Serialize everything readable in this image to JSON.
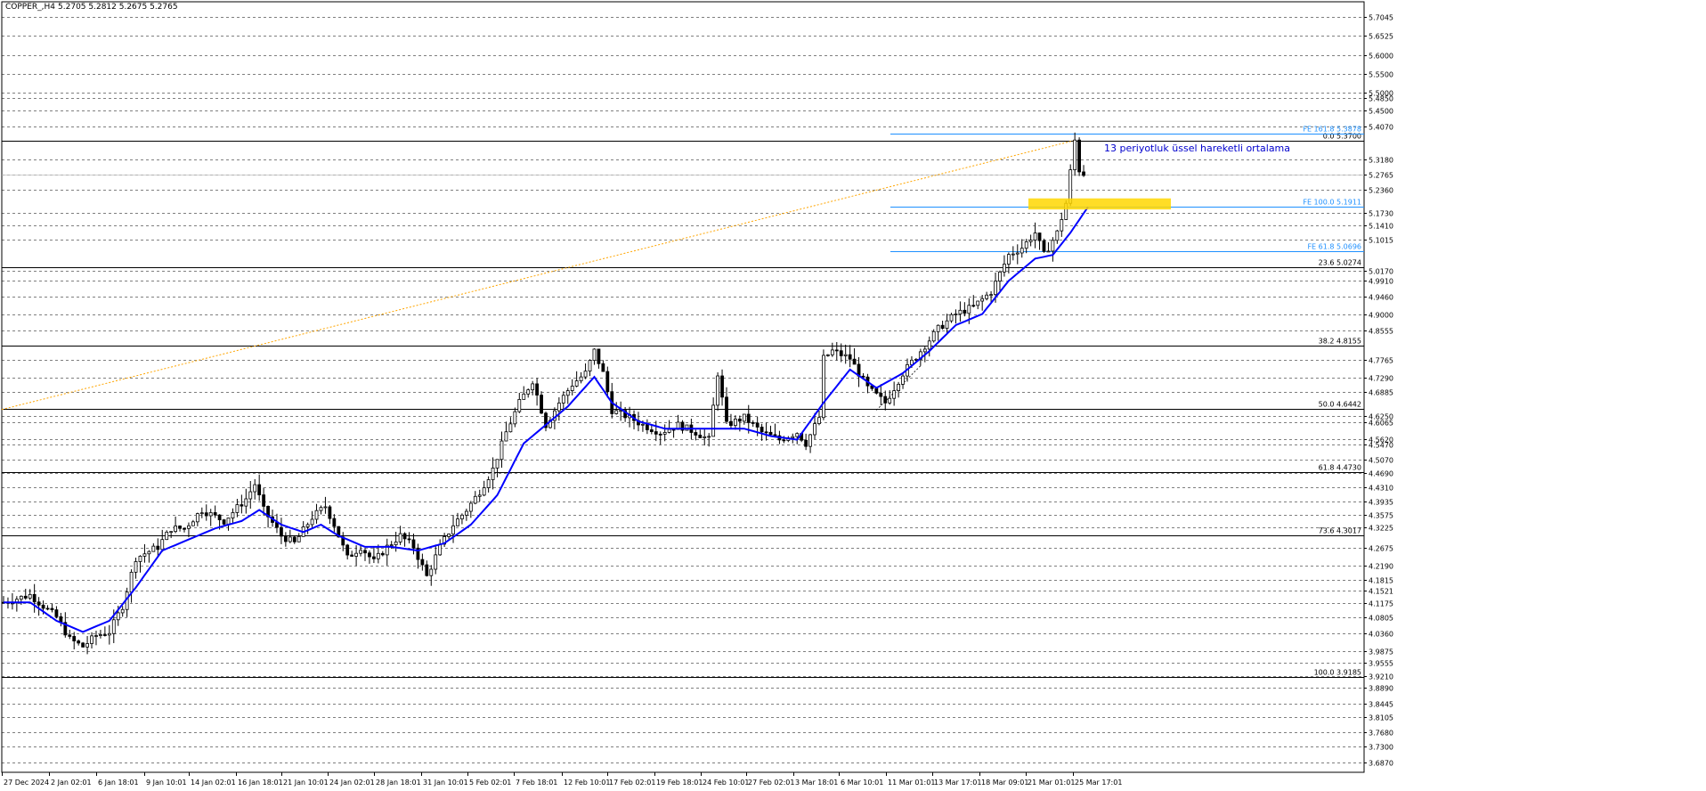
{
  "header": {
    "symbol": "COPPER_,H4",
    "ohlc": "5.2705 5.2812 5.2675 5.2765"
  },
  "chart_data": {
    "type": "candlestick",
    "title": "COPPER_,H4",
    "ylim": [
      3.66,
      5.745
    ],
    "grid": "horizontal dashed",
    "price_labels": [
      "5.7045",
      "5.6525",
      "5.6000",
      "5.5500",
      "5.5000",
      "5.4850",
      "5.4500",
      "5.4070",
      "5.3180",
      "5.2765",
      "5.2360",
      "5.1730",
      "5.1410",
      "5.1015",
      "5.0170",
      "4.9910",
      "4.9460",
      "4.9000",
      "4.8555",
      "4.7765",
      "4.7290",
      "4.6885",
      "4.6250",
      "4.6065",
      "4.5620",
      "4.5470",
      "4.5070",
      "4.4690",
      "4.4310",
      "4.3935",
      "4.3575",
      "4.3225",
      "4.2675",
      "4.2190",
      "4.1815",
      "4.1521",
      "4.1175",
      "4.0805",
      "4.0360",
      "3.9875",
      "3.9555",
      "3.9210",
      "3.8890",
      "3.8445",
      "3.8105",
      "3.7680",
      "3.7300",
      "3.6870"
    ],
    "x_labels": [
      "27 Dec 2024",
      "2 Jan 02:01",
      "6 Jan 18:01",
      "9 Jan 10:01",
      "14 Jan 02:01",
      "16 Jan 18:01",
      "21 Jan 10:01",
      "24 Jan 02:01",
      "28 Jan 18:01",
      "31 Jan 10:01",
      "5 Feb 02:01",
      "7 Feb 18:01",
      "12 Feb 10:01",
      "17 Feb 02:01",
      "19 Feb 18:01",
      "24 Feb 10:01",
      "27 Feb 02:01",
      "3 Mar 18:01",
      "6 Mar 10:01",
      "11 Mar 01:01",
      "13 Mar 17:01",
      "18 Mar 09:01",
      "21 Mar 01:01",
      "25 Mar 17:01"
    ],
    "fib_levels": [
      {
        "label": "0.0 5.3700",
        "value": 5.37
      },
      {
        "label": "23.6 5.0274",
        "value": 5.0274
      },
      {
        "label": "38.2 4.8155",
        "value": 4.8155
      },
      {
        "label": "50.0 4.6442",
        "value": 4.6442
      },
      {
        "label": "61.8 4.4730",
        "value": 4.473
      },
      {
        "label": "73.6 4.3017",
        "value": 4.3017
      },
      {
        "label": "100.0 3.9185",
        "value": 3.9185
      }
    ],
    "fe_levels": [
      {
        "label": "FE 161.8 5.3878",
        "value": 5.3878
      },
      {
        "label": "FE 100.0 5.1911",
        "value": 5.1911
      },
      {
        "label": "FE 61.8 5.0696",
        "value": 5.0696
      }
    ],
    "current_price": 5.2765,
    "annotation": "13 periyotluk üssel hareketli ortalama",
    "colors": {
      "fib_line": "#000000",
      "fe_line": "#1e90ff",
      "ema_line": "#0000ff",
      "trend_line": "#ffa500",
      "highlight": "#ffd700",
      "candle": "#000000",
      "grid": "#000000",
      "annotation": "#0000cd"
    },
    "price_path": [
      [
        0,
        4.12
      ],
      [
        6,
        4.14
      ],
      [
        12,
        4.08
      ],
      [
        15,
        4.02
      ],
      [
        18,
        4.0
      ],
      [
        21,
        4.03
      ],
      [
        24,
        4.04
      ],
      [
        27,
        4.11
      ],
      [
        30,
        4.24
      ],
      [
        35,
        4.27
      ],
      [
        38,
        4.32
      ],
      [
        41,
        4.32
      ],
      [
        45,
        4.37
      ],
      [
        50,
        4.34
      ],
      [
        55,
        4.4
      ],
      [
        57,
        4.44
      ],
      [
        59,
        4.37
      ],
      [
        63,
        4.3
      ],
      [
        66,
        4.28
      ],
      [
        70,
        4.35
      ],
      [
        73,
        4.38
      ],
      [
        75,
        4.33
      ],
      [
        78,
        4.24
      ],
      [
        81,
        4.27
      ],
      [
        84,
        4.23
      ],
      [
        87,
        4.27
      ],
      [
        90,
        4.3
      ],
      [
        93,
        4.27
      ],
      [
        96,
        4.19
      ],
      [
        99,
        4.27
      ],
      [
        102,
        4.33
      ],
      [
        105,
        4.37
      ],
      [
        108,
        4.42
      ],
      [
        111,
        4.48
      ],
      [
        114,
        4.58
      ],
      [
        117,
        4.66
      ],
      [
        120,
        4.72
      ],
      [
        123,
        4.6
      ],
      [
        126,
        4.66
      ],
      [
        129,
        4.71
      ],
      [
        132,
        4.74
      ],
      [
        134,
        4.8
      ],
      [
        136,
        4.74
      ],
      [
        138,
        4.64
      ],
      [
        142,
        4.62
      ],
      [
        145,
        4.6
      ],
      [
        149,
        4.58
      ],
      [
        153,
        4.6
      ],
      [
        157,
        4.58
      ],
      [
        160,
        4.56
      ],
      [
        162,
        4.74
      ],
      [
        164,
        4.6
      ],
      [
        168,
        4.62
      ],
      [
        172,
        4.58
      ],
      [
        176,
        4.56
      ],
      [
        180,
        4.58
      ],
      [
        182,
        4.55
      ],
      [
        185,
        4.62
      ],
      [
        186,
        4.78
      ],
      [
        188,
        4.8
      ],
      [
        192,
        4.78
      ],
      [
        196,
        4.7
      ],
      [
        200,
        4.66
      ],
      [
        204,
        4.74
      ],
      [
        208,
        4.8
      ],
      [
        212,
        4.86
      ],
      [
        216,
        4.9
      ],
      [
        220,
        4.92
      ],
      [
        224,
        4.96
      ],
      [
        228,
        5.06
      ],
      [
        231,
        5.08
      ],
      [
        234,
        5.12
      ],
      [
        236,
        5.06
      ],
      [
        239,
        5.12
      ],
      [
        241,
        5.2
      ],
      [
        243,
        5.37
      ],
      [
        244,
        5.29
      ],
      [
        245,
        5.28
      ]
    ],
    "ema_path": [
      [
        0,
        4.12
      ],
      [
        6,
        4.12
      ],
      [
        12,
        4.07
      ],
      [
        18,
        4.04
      ],
      [
        24,
        4.07
      ],
      [
        30,
        4.16
      ],
      [
        36,
        4.26
      ],
      [
        42,
        4.29
      ],
      [
        48,
        4.32
      ],
      [
        54,
        4.34
      ],
      [
        58,
        4.37
      ],
      [
        63,
        4.33
      ],
      [
        68,
        4.31
      ],
      [
        72,
        4.33
      ],
      [
        76,
        4.3
      ],
      [
        82,
        4.27
      ],
      [
        88,
        4.27
      ],
      [
        94,
        4.26
      ],
      [
        100,
        4.28
      ],
      [
        106,
        4.33
      ],
      [
        112,
        4.41
      ],
      [
        118,
        4.55
      ],
      [
        123,
        4.6
      ],
      [
        128,
        4.65
      ],
      [
        134,
        4.73
      ],
      [
        138,
        4.66
      ],
      [
        144,
        4.61
      ],
      [
        150,
        4.59
      ],
      [
        156,
        4.59
      ],
      [
        162,
        4.59
      ],
      [
        168,
        4.59
      ],
      [
        174,
        4.57
      ],
      [
        180,
        4.56
      ],
      [
        186,
        4.66
      ],
      [
        192,
        4.75
      ],
      [
        198,
        4.7
      ],
      [
        204,
        4.74
      ],
      [
        210,
        4.8
      ],
      [
        216,
        4.87
      ],
      [
        222,
        4.9
      ],
      [
        228,
        4.99
      ],
      [
        234,
        5.05
      ],
      [
        238,
        5.06
      ],
      [
        242,
        5.12
      ],
      [
        246,
        5.19
      ]
    ],
    "num_slots": 246
  }
}
